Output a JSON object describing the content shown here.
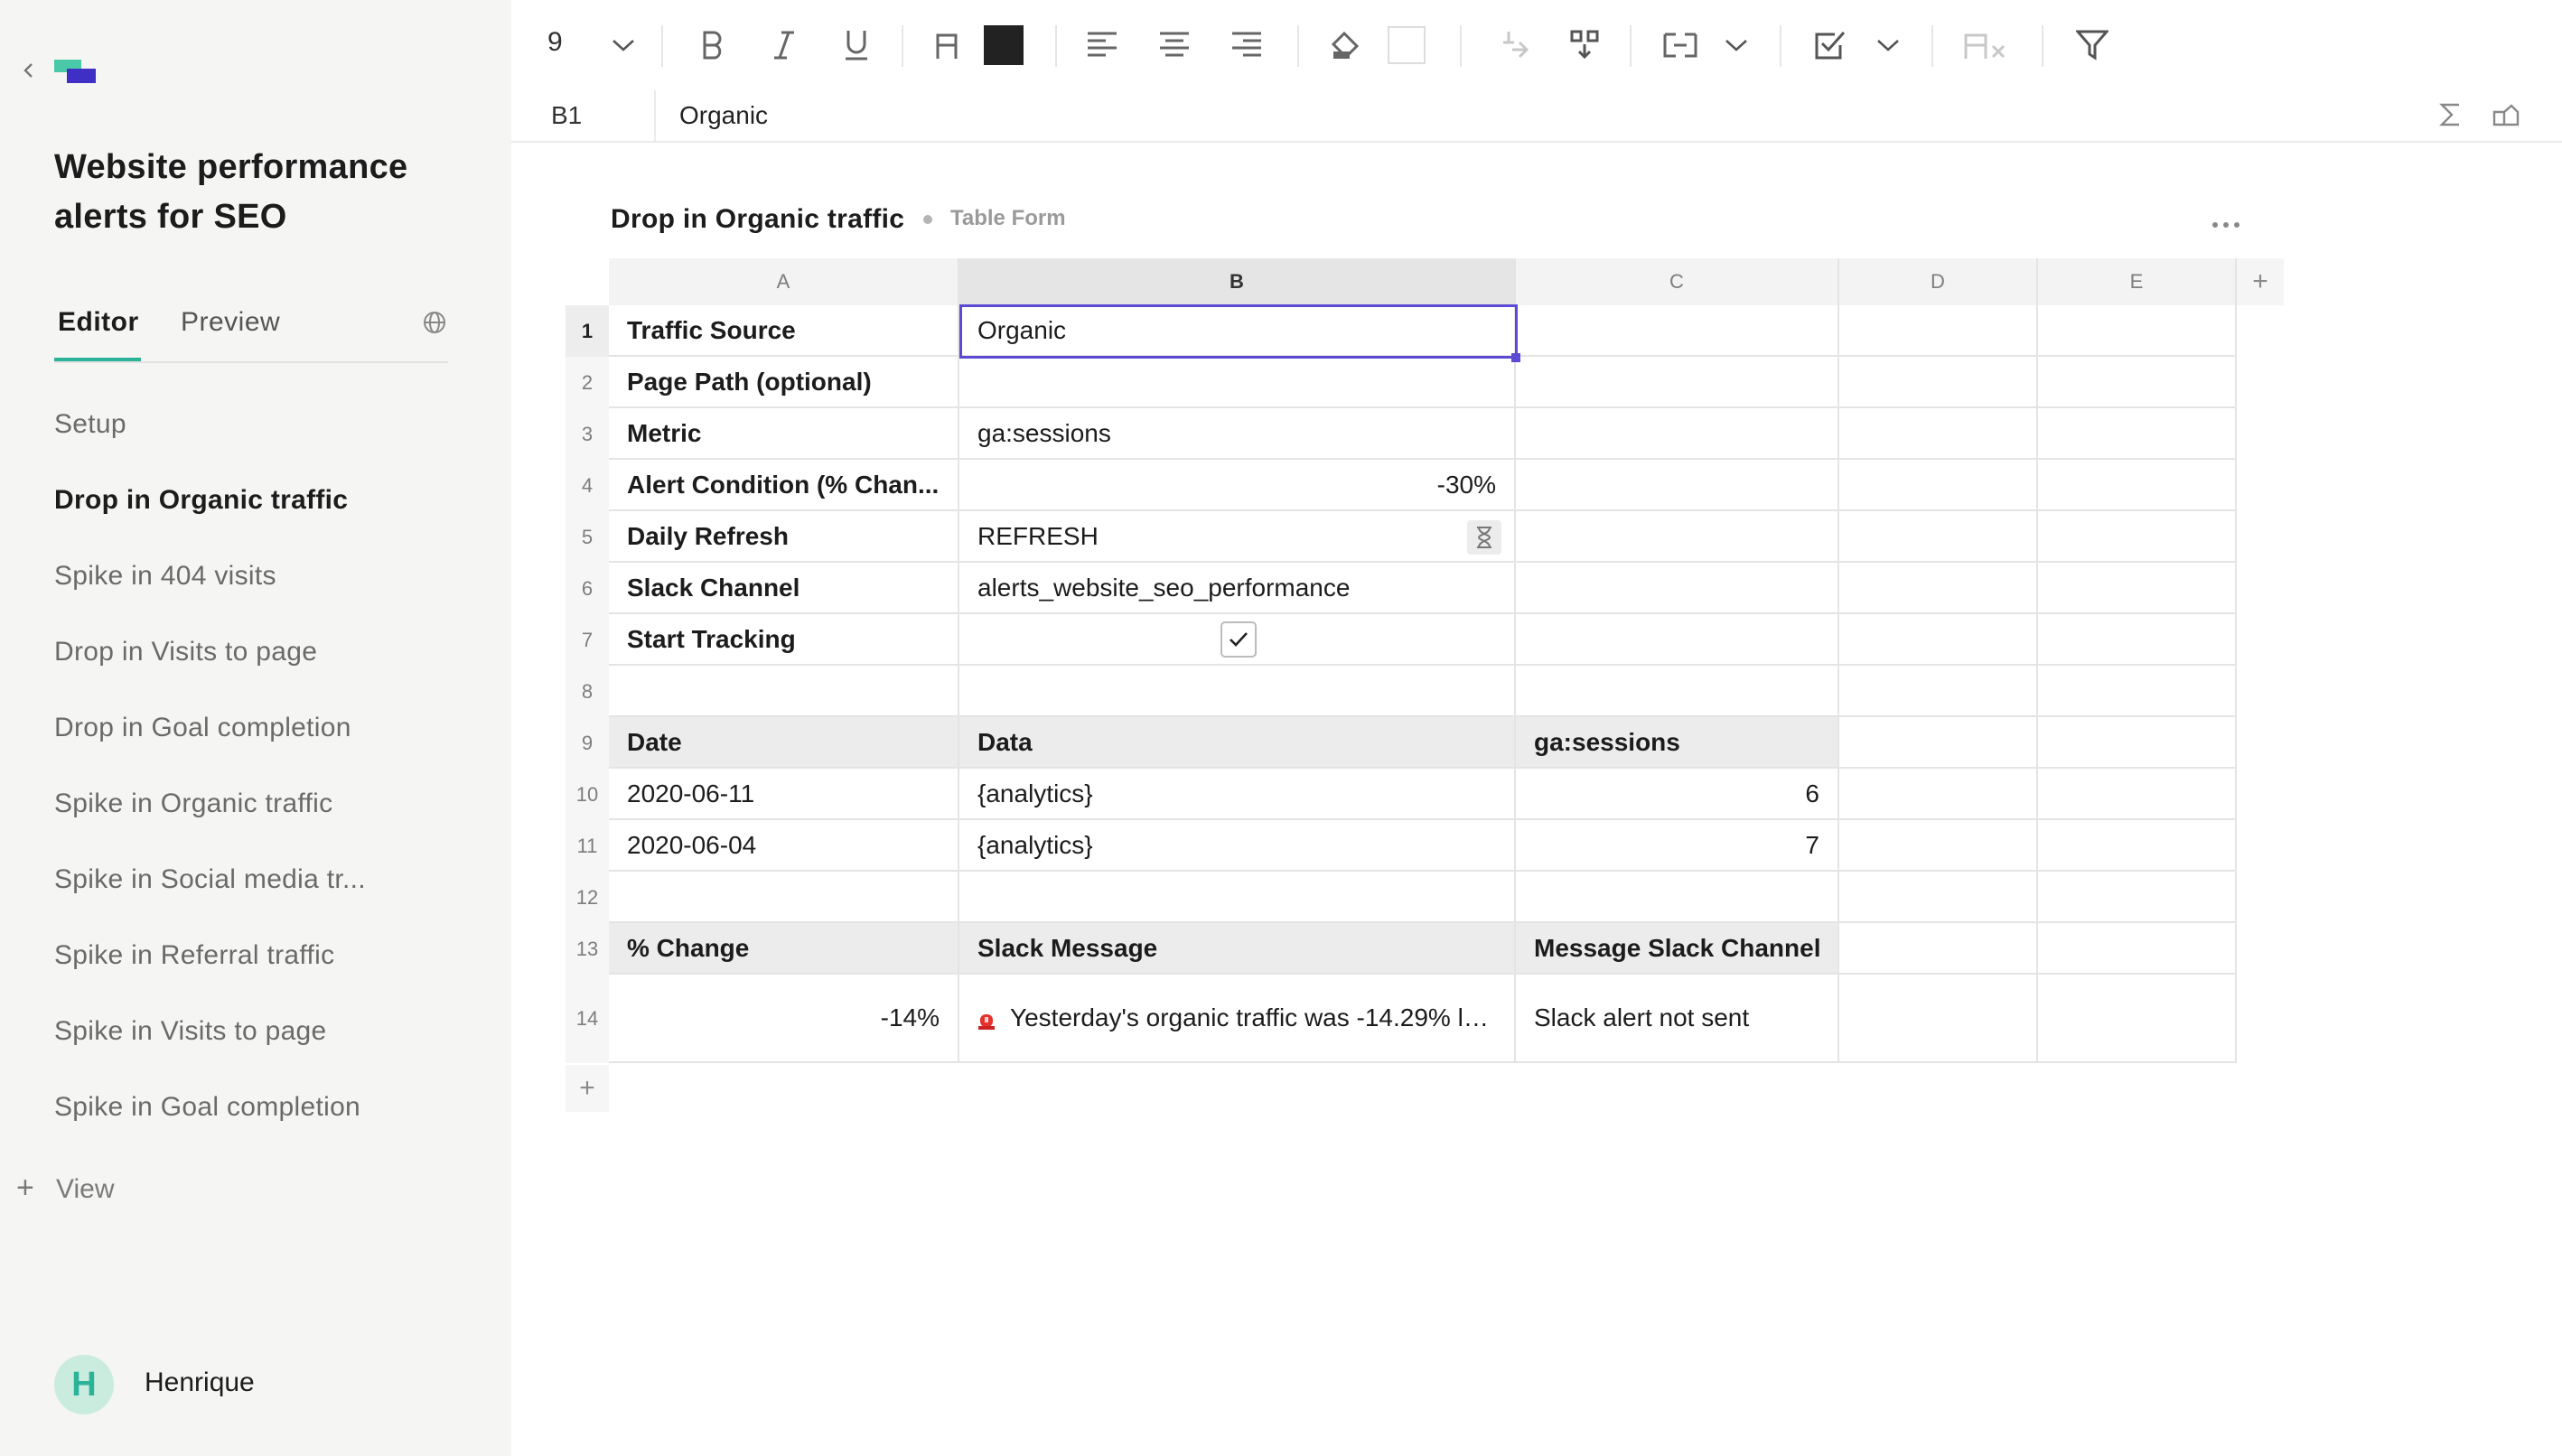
{
  "sidebar": {
    "title": "Website performance alerts for SEO",
    "tabs": [
      {
        "label": "Editor",
        "active": true
      },
      {
        "label": "Preview",
        "active": false
      }
    ],
    "items": [
      {
        "label": "Setup",
        "active": false
      },
      {
        "label": "Drop in Organic traffic",
        "active": true
      },
      {
        "label": "Spike in 404 visits",
        "active": false
      },
      {
        "label": "Drop in Visits to page",
        "active": false
      },
      {
        "label": "Drop in Goal completion",
        "active": false
      },
      {
        "label": "Spike in Organic traffic",
        "active": false
      },
      {
        "label": "Spike in Social media tr...",
        "active": false
      },
      {
        "label": "Spike in Referral traffic",
        "active": false
      },
      {
        "label": "Spike in Visits to page",
        "active": false
      },
      {
        "label": "Spike in Goal completion",
        "active": false
      }
    ],
    "add_view_label": "View",
    "user": {
      "initial": "H",
      "name": "Henrique"
    }
  },
  "toolbar": {
    "font_size": "9",
    "text_color": "#222222",
    "fill_color": "#ffffff",
    "icons": [
      "bold-icon",
      "italic-icon",
      "underline-icon",
      "strike-icon",
      "align-left-icon",
      "align-center-icon",
      "align-right-icon",
      "fill-bucket-icon",
      "cut-icon",
      "paste-icon",
      "wrap-icon",
      "checkbox-icon",
      "clear-format-icon",
      "filter-icon"
    ]
  },
  "formula_bar": {
    "cell_ref": "B1",
    "value": "Organic"
  },
  "sheet": {
    "title": "Drop in Organic traffic",
    "subtitle": "Table Form",
    "columns": [
      "A",
      "B",
      "C",
      "D",
      "E"
    ],
    "selected_column": "B",
    "rows": {
      "r1": {
        "num": "1",
        "a": "Traffic Source",
        "b": "Organic"
      },
      "r2": {
        "num": "2",
        "a": "Page Path (optional)"
      },
      "r3": {
        "num": "3",
        "a": "Metric",
        "b": "ga:sessions"
      },
      "r4": {
        "num": "4",
        "a": "Alert Condition (% Chan...",
        "b": "-30%"
      },
      "r5": {
        "num": "5",
        "a": "Daily Refresh",
        "b": "REFRESH"
      },
      "r6": {
        "num": "6",
        "a": "Slack Channel",
        "b": "alerts_website_seo_performance"
      },
      "r7": {
        "num": "7",
        "a": "Start Tracking",
        "b_checked": true
      },
      "r8": {
        "num": "8"
      },
      "r9": {
        "num": "9",
        "a": "Date",
        "b": "Data",
        "c": "ga:sessions"
      },
      "r10": {
        "num": "10",
        "a": "2020-06-11",
        "b": "{analytics}",
        "c": "6"
      },
      "r11": {
        "num": "11",
        "a": "2020-06-04",
        "b": "{analytics}",
        "c": "7"
      },
      "r12": {
        "num": "12"
      },
      "r13": {
        "num": "13",
        "a": "% Change",
        "b": "Slack Message",
        "c": "Message Slack Channel"
      },
      "r14": {
        "num": "14",
        "a": "-14%",
        "b": "Yesterday's organic traffic was -14.29% lo...",
        "c": "Slack alert not sent"
      }
    }
  },
  "colors": {
    "accent": "#2bb39a",
    "selection": "#5b4bd4",
    "alarm": "#e5322d"
  }
}
